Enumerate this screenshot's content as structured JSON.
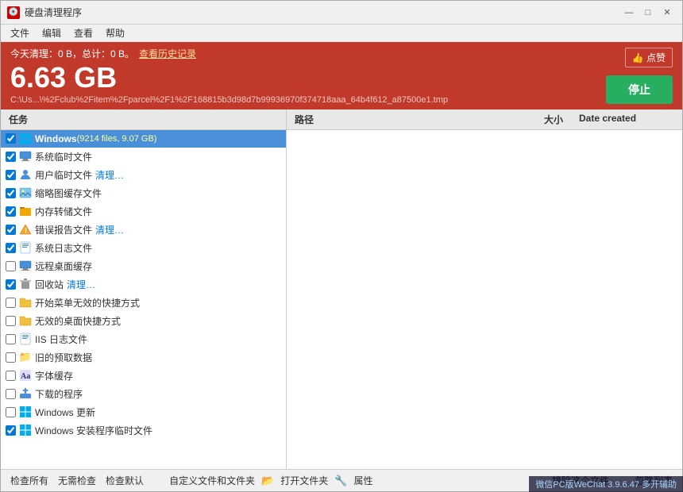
{
  "window": {
    "title": "硬盘清理程序",
    "min_btn": "—",
    "max_btn": "□",
    "close_btn": "✕"
  },
  "menu": {
    "items": [
      "文件",
      "编辑",
      "查看",
      "帮助"
    ]
  },
  "status": {
    "today_label": "今天清理：0 B，总计：0 B。",
    "history_link": "查看历史记录",
    "like_label": "👍 点赞",
    "size": "6.63 GB",
    "path": "C:\\Us...\\%2Fclub%2Fitem%2Fparcel%2F1%2F168815b3d98d7b99936970f374718aaa_64b4f612_a87500e1.tmp",
    "stop_btn": "停止"
  },
  "panels": {
    "task_header": "任务",
    "right_path_header": "路径",
    "right_size_header": "大小",
    "right_date_header": "Date created"
  },
  "tasks": [
    {
      "id": "windows-header",
      "checked": true,
      "icon": "🪟",
      "label": "Windows",
      "extra": "(9214 files, 9.07 GB)",
      "is_header": true
    },
    {
      "id": "sys-temp",
      "checked": true,
      "icon": "🖥️",
      "label": "系统临时文件",
      "extra": ""
    },
    {
      "id": "user-temp",
      "checked": true,
      "icon": "👤",
      "label": "用户临时文件",
      "extra": "清理…",
      "extra_class": "cleaning"
    },
    {
      "id": "thumb-cache",
      "checked": true,
      "icon": "🖼️",
      "label": "缩略图缓存文件",
      "extra": ""
    },
    {
      "id": "mem-dump",
      "checked": true,
      "icon": "🗂️",
      "label": "内存转储文件",
      "extra": ""
    },
    {
      "id": "error-report",
      "checked": true,
      "icon": "⚠️",
      "label": "错误报告文件",
      "extra": "清理…",
      "extra_class": "cleaning"
    },
    {
      "id": "sys-log",
      "checked": true,
      "icon": "📋",
      "label": "系统日志文件",
      "extra": ""
    },
    {
      "id": "remote-desktop",
      "checked": false,
      "icon": "🖥️",
      "label": "远程桌面缓存",
      "extra": ""
    },
    {
      "id": "recycle",
      "checked": true,
      "icon": "🗑️",
      "label": "回收站",
      "extra": "清理…",
      "extra_class": "cleaning"
    },
    {
      "id": "start-menu-shortcuts",
      "checked": false,
      "icon": "📂",
      "label": "开始菜单无效的快捷方式",
      "extra": ""
    },
    {
      "id": "desktop-shortcuts",
      "checked": false,
      "icon": "📂",
      "label": "无效的桌面快捷方式",
      "extra": ""
    },
    {
      "id": "iis-log",
      "checked": false,
      "icon": "📋",
      "label": "IIS 日志文件",
      "extra": ""
    },
    {
      "id": "old-prefetch",
      "checked": false,
      "icon": "📁",
      "label": "旧的预取数据",
      "extra": ""
    },
    {
      "id": "font-cache",
      "checked": false,
      "icon": "🔤",
      "label": "字体缓存",
      "extra": ""
    },
    {
      "id": "downloaded-programs",
      "checked": false,
      "icon": "📥",
      "label": "下载的程序",
      "extra": ""
    },
    {
      "id": "windows-update",
      "checked": false,
      "icon": "🪟",
      "label": "Windows 更新",
      "extra": ""
    },
    {
      "id": "windows-installer-temp",
      "checked": true,
      "icon": "🪟",
      "label": "Windows 安装程序临时文件",
      "extra": ""
    }
  ],
  "bottom_bar": {
    "check_all": "检查所有",
    "no_check": "无需检查",
    "check_default": "检查默认",
    "custom_files": "自定义文件和文件夹",
    "open_file": "打开文件夹",
    "properties": "属性",
    "exclude_file": "排除这个文件",
    "hide_list": "忽略列表"
  },
  "watermark": {
    "text": "微信PC版WeChat 3.9.6.47 多开辅助"
  }
}
